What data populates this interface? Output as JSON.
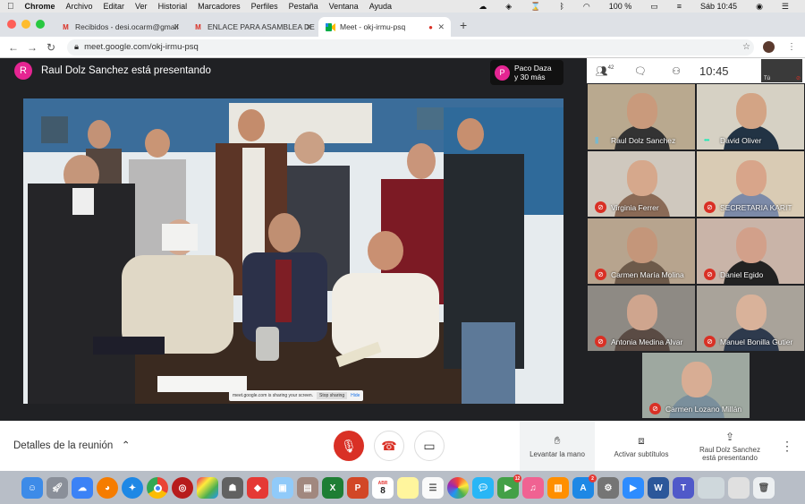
{
  "menubar": {
    "app": "Chrome",
    "items": [
      "Archivo",
      "Editar",
      "Ver",
      "Historial",
      "Marcadores",
      "Perfiles",
      "Pestaña",
      "Ventana",
      "Ayuda"
    ],
    "battery": "100 %",
    "clock": "Sáb 10:45"
  },
  "tabs": [
    {
      "title": "Recibidos - desi.ocarm@gmail",
      "icon": "gmail-icon"
    },
    {
      "title": "ENLACE PARA ASAMBLEA DE",
      "icon": "gmail-icon"
    },
    {
      "title": "Meet - okj-irmu-psq",
      "icon": "meet-icon"
    }
  ],
  "address": {
    "url": "meet.google.com/okj-irmu-psq"
  },
  "meet": {
    "presenter_initial": "R",
    "presenter_text": "Raul Dolz Sanchez está presentando",
    "others_initial": "P",
    "others_line1": "Paco Daza",
    "others_line2": "y 30 más",
    "participant_count": "42",
    "clock": "10:45",
    "self_label": "Tú",
    "share_notice": "meet.google.com is sharing your screen.",
    "stop_sharing": "Stop sharing",
    "hide": "Hide"
  },
  "participants": [
    {
      "name": "Raul Dolz Sanchez",
      "status": "speaking",
      "bg": "#b9a98f",
      "skin": "#c99a7c",
      "shirt": "#333333"
    },
    {
      "name": "David Oliver",
      "status": "speaking",
      "bg": "#d6d1c4",
      "skin": "#d3a485",
      "shirt": "#223344"
    },
    {
      "name": "Virginia Ferrer",
      "status": "muted",
      "bg": "#cfc8be",
      "skin": "#d6a88c",
      "shirt": "#8a6a56"
    },
    {
      "name": "SECRETARIA KARIT",
      "status": "muted",
      "bg": "#d9cbb4",
      "skin": "#d8a58a",
      "shirt": "#7c8aa8"
    },
    {
      "name": "Carmen María Molina",
      "status": "muted",
      "bg": "#b7a48e",
      "skin": "#c4967a",
      "shirt": "#6d5a4a"
    },
    {
      "name": "Daniel Egido",
      "status": "muted",
      "bg": "#c9b4a8",
      "skin": "#d2a08a",
      "shirt": "#222222"
    },
    {
      "name": "Antonia Medina Alvar",
      "status": "muted",
      "bg": "#8e8a84",
      "skin": "#cfa58e",
      "shirt": "#5a4b44"
    },
    {
      "name": "Manuel Bonilla Gutier",
      "status": "muted",
      "bg": "#a9a39a",
      "skin": "#d9b29a",
      "shirt": "#2e3a4d"
    },
    {
      "name": "Carmen Lozano Millán",
      "status": "muted",
      "bg": "#9ea8a0",
      "skin": "#d8ad94",
      "shirt": "#7a8f9c"
    }
  ],
  "controls": {
    "details": "Detalles de la reunión",
    "raise_hand": "Levantar la mano",
    "captions": "Activar subtítulos",
    "presenting_line1": "Raul Dolz Sanchez",
    "presenting_line2": "está presentando"
  },
  "dock": {
    "calendar_month": "ABR",
    "calendar_day": "8",
    "facetime_badge": "12",
    "appstore_badge": "2"
  },
  "colors": {
    "accent": "#e52592",
    "danger": "#d93025",
    "meet_bg": "#202124"
  }
}
